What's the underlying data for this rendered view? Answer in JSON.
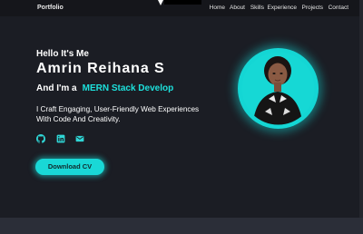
{
  "nav": {
    "brand": "Portfolio",
    "links": [
      "Home",
      "About",
      "Skills",
      "Experience",
      "Projects",
      "Contact"
    ]
  },
  "hero": {
    "greeting": "Hello It's Me",
    "name": "Amrin Reihana S",
    "role_prefix": "And I'm a",
    "role": "MERN Stack Develop",
    "tagline": "I Craft Engaging, User-Friendly Web Experiences With Code And Creativity.",
    "cta_label": "Download CV",
    "socials": [
      "github-icon",
      "linkedin-icon",
      "mail-icon"
    ]
  },
  "colors": {
    "accent": "#1de1dc",
    "background": "#1b1d24",
    "navbar": "#15161b"
  }
}
